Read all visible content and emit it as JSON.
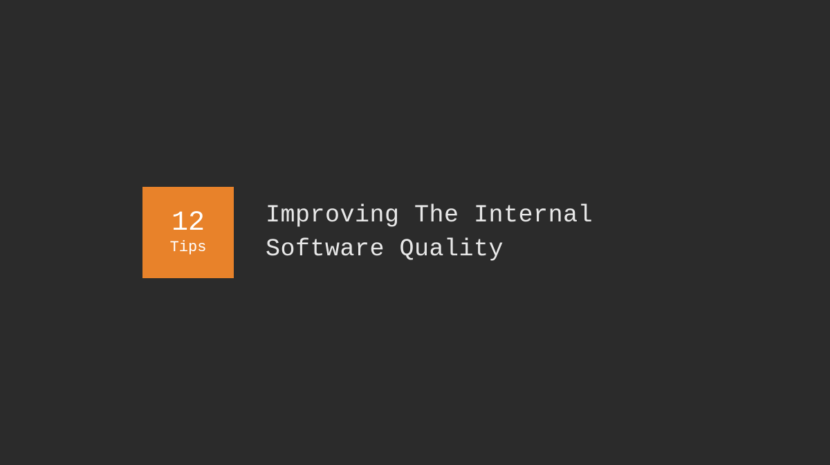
{
  "badge": {
    "number": "12",
    "label": "Tips"
  },
  "title": "Improving The Internal\nSoftware Quality"
}
